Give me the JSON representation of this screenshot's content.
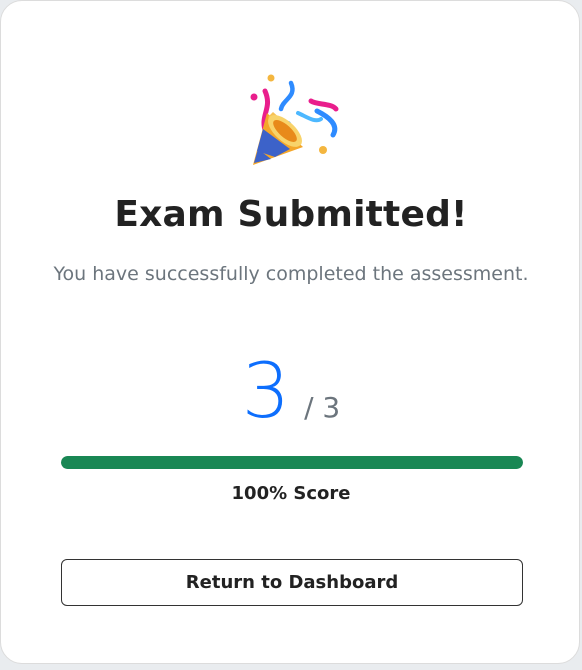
{
  "header": {
    "icon": "party-popper-icon",
    "title": "Exam Submitted!",
    "subtitle": "You have successfully completed the assessment."
  },
  "score": {
    "correct": "3",
    "total_text": "/ 3",
    "progress_percent": 100,
    "label": "100% Score"
  },
  "actions": {
    "return_label": "Return to Dashboard"
  },
  "colors": {
    "accent": "#0d6efd",
    "success": "#198754",
    "text_primary": "#222222",
    "text_muted": "#6c757d"
  }
}
